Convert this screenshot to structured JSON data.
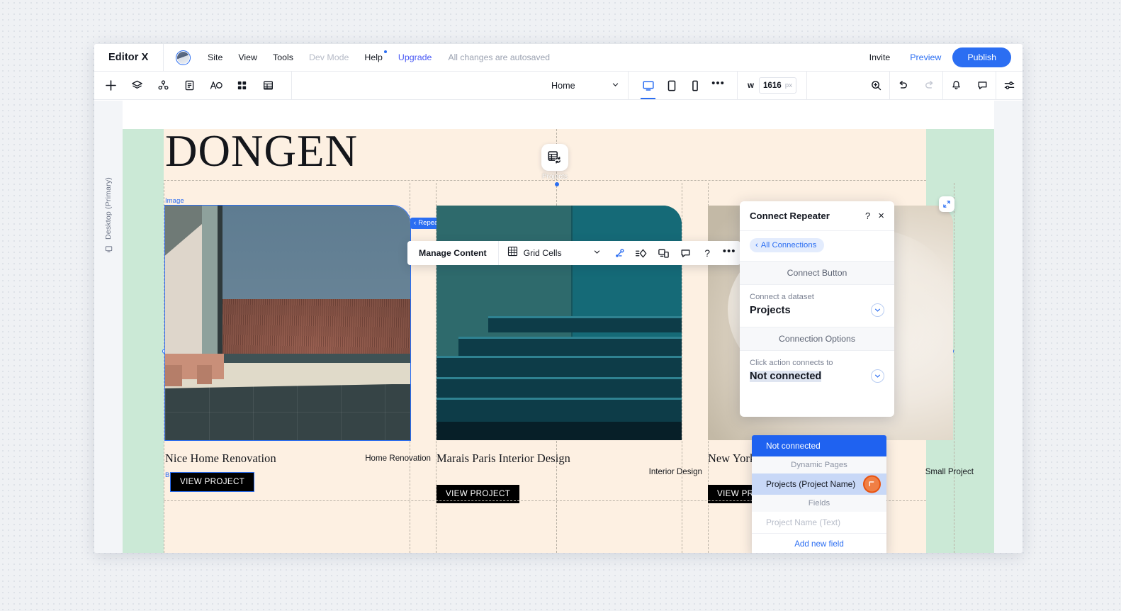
{
  "topbar": {
    "brand": "Editor X",
    "menu": [
      {
        "label": "Site",
        "state": "normal"
      },
      {
        "label": "View",
        "state": "normal"
      },
      {
        "label": "Tools",
        "state": "normal"
      },
      {
        "label": "Dev Mode",
        "state": "disabled"
      },
      {
        "label": "Help",
        "state": "normal",
        "badge": true
      },
      {
        "label": "Upgrade",
        "state": "accent"
      }
    ],
    "autosave": "All changes are autosaved",
    "invite": "Invite",
    "preview": "Preview",
    "publish": "Publish"
  },
  "toolbar": {
    "left_icons": [
      "add-icon",
      "layers-icon",
      "site-structure-icon",
      "pages-icon",
      "text-icon",
      "apps-icon",
      "cms-icon"
    ],
    "page_select": "Home",
    "viewports": [
      {
        "name": "desktop",
        "active": true
      },
      {
        "name": "tablet",
        "active": false
      },
      {
        "name": "mobile",
        "active": false
      }
    ],
    "more": "•••",
    "width_label": "w",
    "width_value": "1616",
    "width_unit": "px",
    "right_icons": [
      "zoom-icon",
      "undo-icon",
      "redo-icon",
      "notifications-icon",
      "comments-icon",
      "settings-icon"
    ]
  },
  "canvas": {
    "viewport_label": "Desktop (Primary)",
    "hero_title": "DONGEN",
    "image_tag": "Image",
    "repeater_tag": "Repeater",
    "button_tag": "Button",
    "dataset_badge": "Projects",
    "cards": [
      {
        "title": "Nice Home Renovation",
        "category": "Home Renovation",
        "button": "VIEW PROJECT",
        "selected": true
      },
      {
        "title": "Marais Paris Interior Design",
        "category": "Interior Design",
        "button": "VIEW PROJECT",
        "selected": false
      },
      {
        "title": "New York Kitchen Redesign",
        "category": "Small Project",
        "button": "VIEW PROJECT",
        "selected": false
      }
    ]
  },
  "manage_content_toolbar": {
    "label": "Manage Content",
    "selector_label": "Grid Cells",
    "icons": [
      "connect-data-icon",
      "animation-icon",
      "responsive-icon",
      "comment-icon",
      "help-icon",
      "more-icon"
    ]
  },
  "connect_panel": {
    "title": "Connect Repeater",
    "help": "?",
    "close": "×",
    "breadcrumb": "All Connections",
    "section_connect": "Connect Button",
    "dataset_label": "Connect a dataset",
    "dataset_value": "Projects",
    "section_options": "Connection Options",
    "click_action_label": "Click action connects to",
    "click_action_value": "Not connected",
    "dropdown": {
      "items": [
        {
          "label": "Not connected",
          "type": "item",
          "state": "selected"
        },
        {
          "label": "Dynamic Pages",
          "type": "group"
        },
        {
          "label": "Projects (Project Name)",
          "type": "item",
          "state": "hover"
        },
        {
          "label": "Fields",
          "type": "group"
        },
        {
          "label": "Project Name (Text)",
          "type": "item",
          "state": "disabled"
        }
      ],
      "add_new_field": "Add new field"
    }
  },
  "colors": {
    "accent": "#2b6ef2",
    "page_bg": "#fdf0e2",
    "site_bg": "#cbe9d6",
    "button_bg": "#000000",
    "dropdown_selected": "#1f62f0",
    "cursor": "#f07f45"
  }
}
